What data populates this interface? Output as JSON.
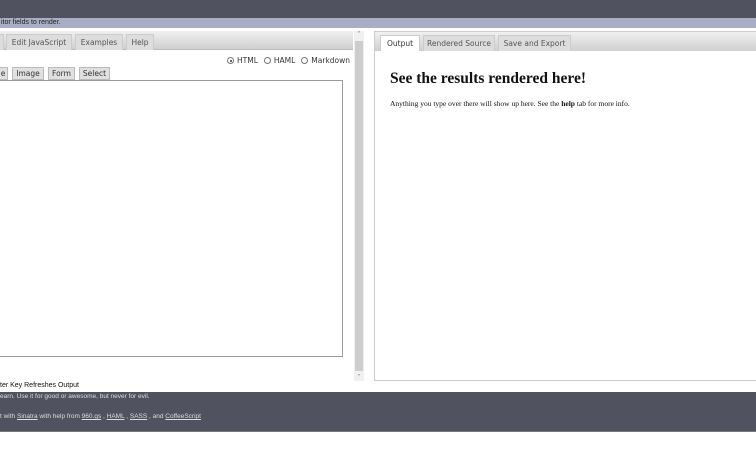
{
  "status_text": "itor fields to render.",
  "left_tabs": [
    "Edit JavaScript",
    "Examples",
    "Help"
  ],
  "modes": [
    {
      "label": "HTML",
      "selected": true
    },
    {
      "label": "HAML",
      "selected": false
    },
    {
      "label": "Markdown",
      "selected": false
    }
  ],
  "snippets": [
    "e",
    "Image",
    "Form",
    "Select"
  ],
  "right_tabs": [
    "Output",
    "Rendered Source",
    "Save and Export"
  ],
  "output": {
    "heading": "See the results rendered here!",
    "text_before": "Anything you type over there will show up here. See the ",
    "text_bold": "help",
    "text_after": " tab for more info."
  },
  "key_note": "ter Key Refreshes Output",
  "footer": {
    "line1": "earn. Use it for good or awesome, but never for evil.",
    "prefix": "t with ",
    "sinatra": "Sinatra",
    "with_help": " with help from ",
    "grid": "960.gs",
    "sep1": " , ",
    "haml": "HAML",
    "sep2": " , ",
    "sass": "SASS",
    "sep3": " , and ",
    "coffee": "CoffeeScript"
  }
}
